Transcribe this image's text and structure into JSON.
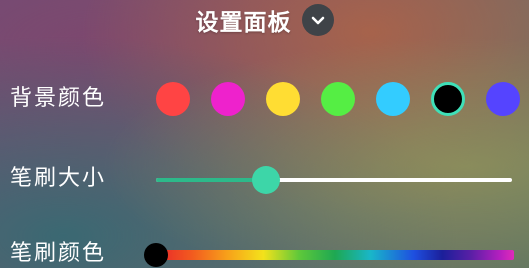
{
  "header": {
    "title": "设置面板",
    "collapse_icon": "chevron-down-icon"
  },
  "background_color": {
    "label": "背景颜色",
    "swatches": [
      "#ff4444",
      "#ee22cc",
      "#ffdd33",
      "#55ee44",
      "#33ccff",
      "#000000",
      "#5544ff"
    ],
    "selected_index": 5,
    "selected_ring_color": "#3fe0b8"
  },
  "brush_size": {
    "label": "笔刷大小",
    "value_fraction": 0.31,
    "track_color": "#ffffff",
    "fill_color": "#2db98a",
    "thumb_color": "#3dd6a8"
  },
  "brush_color": {
    "label": "笔刷颜色",
    "thumb_fraction": 0.0,
    "thumb_color": "#000000"
  }
}
